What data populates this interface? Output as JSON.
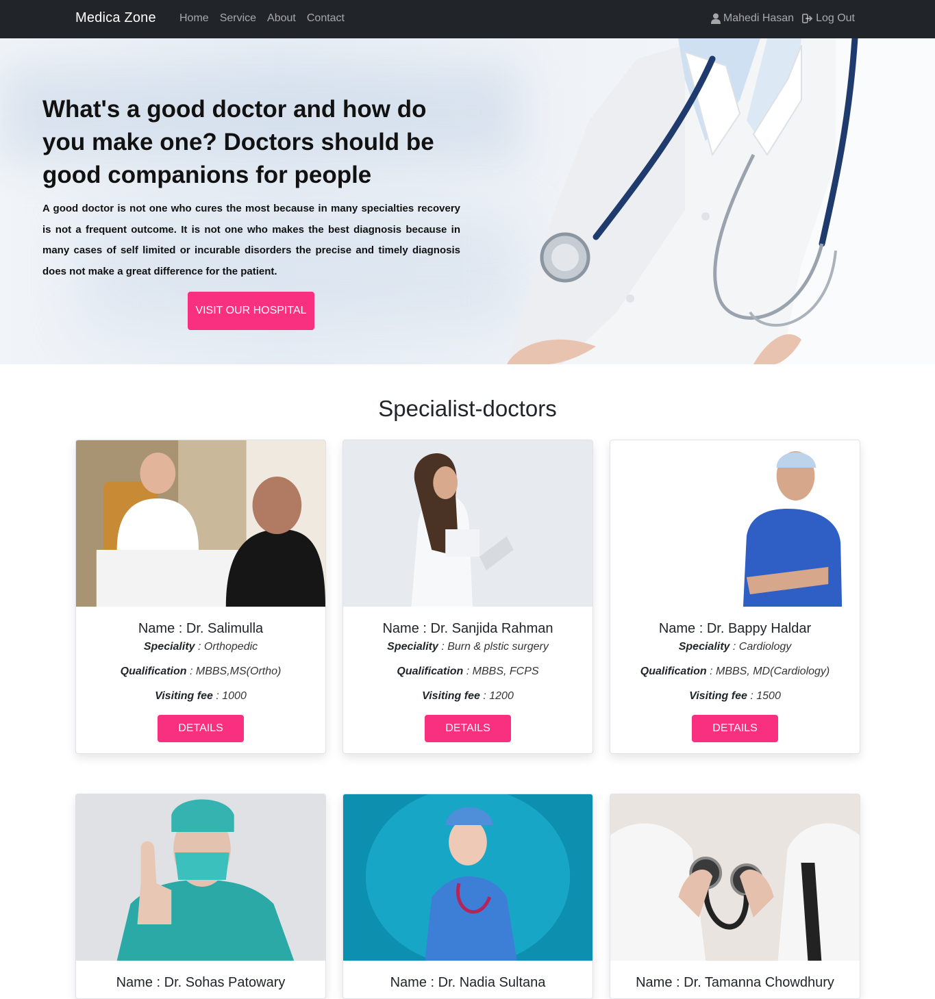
{
  "nav": {
    "brand": "Medica Zone",
    "links": [
      "Home",
      "Service",
      "About",
      "Contact"
    ],
    "user_name": "Mahedi Hasan",
    "logout_label": "Log Out",
    "user_icon": "user-icon",
    "logout_icon": "sign-out-icon"
  },
  "hero": {
    "title": "What's a good doctor and how do you make one? Doctors should be good companions for people",
    "description": "A good doctor is not one who cures the most because in many specialties recovery is not a frequent outcome. It is not one who makes the best diagnosis because in many cases of self limited or incurable disorders the precise and timely diagnosis does not make a great difference for the patient.",
    "button_label": "VISIT OUR HOSPITAL",
    "accent_color": "#f8307f"
  },
  "section": {
    "title": "Specialist-doctors"
  },
  "labels": {
    "name_prefix": "Name : ",
    "speciality": "Speciality",
    "qualification": "Qualification",
    "visiting_fee": "Visiting fee",
    "details_button": "DETAILS"
  },
  "doctors": [
    {
      "name": "Name : Dr. Salimulla",
      "speciality": " : Orthopedic",
      "qualification": " : MBBS,MS(Ortho)",
      "fee": " : 1000"
    },
    {
      "name": "Name : Dr. Sanjida Rahman",
      "speciality": " : Burn & plstic surgery",
      "qualification": " : MBBS, FCPS",
      "fee": " : 1200"
    },
    {
      "name": "Name : Dr. Bappy Haldar",
      "speciality": " : Cardiology",
      "qualification": " : MBBS, MD(Cardiology)",
      "fee": " : 1500"
    },
    {
      "name": "Name : Dr. Sohas Patowary"
    },
    {
      "name": "Name : Dr. Nadia Sultana"
    },
    {
      "name": "Name : Dr. Tamanna Chowdhury"
    }
  ]
}
